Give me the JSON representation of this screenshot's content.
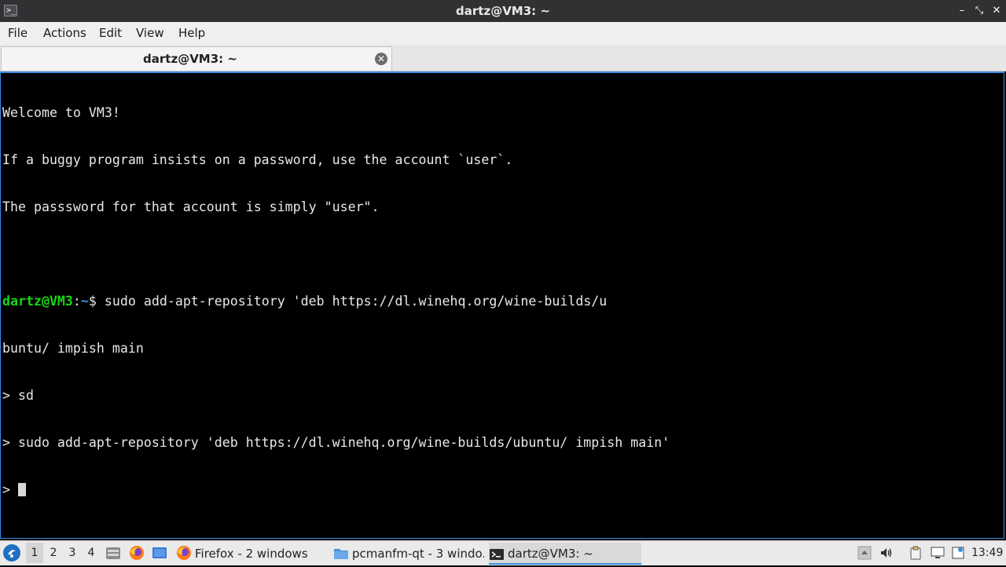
{
  "window": {
    "title": "dartz@VM3: ~",
    "app_icon": "terminal-icon",
    "app_icon_glyph": ">_",
    "controls": {
      "minimize": "–",
      "maximize": "⤡",
      "close": "✕"
    }
  },
  "menubar": {
    "items": [
      "File",
      "Actions",
      "Edit",
      "View",
      "Help"
    ]
  },
  "tabs": [
    {
      "label": "dartz@VM3: ~",
      "close_icon": "close-circle-icon",
      "close_glyph": "✕"
    }
  ],
  "terminal": {
    "lines": [
      "Welcome to VM3!",
      "If a buggy program insists on a password, use the account `user`.",
      "The passsword for that account is simply \"user\".",
      ""
    ],
    "prompt": {
      "user_host": "dartz@VM3",
      "colon": ":",
      "path": "~",
      "symbol": "$",
      "command": " sudo add-apt-repository 'deb https://dl.winehq.org/wine-builds/u"
    },
    "continuation_lines": [
      "buntu/ impish main",
      "> sd",
      "> sudo add-apt-repository 'deb https://dl.winehq.org/wine-builds/ubuntu/ impish main'"
    ],
    "current_prompt": "> "
  },
  "taskbar": {
    "start_icon": "start-menu-icon",
    "desktops": [
      "1",
      "2",
      "3",
      "4"
    ],
    "active_desktop": "1",
    "quicklaunch": [
      "file-manager-icon",
      "firefox-icon",
      "show-desktop-icon"
    ],
    "tasks": [
      {
        "label": "Firefox - 2 windows",
        "icon": "firefox-icon"
      },
      {
        "label": "pcmanfm-qt - 3 windo...",
        "icon": "folder-icon"
      },
      {
        "label": "dartz@VM3: ~",
        "icon": "terminal-icon"
      }
    ],
    "tray": [
      "tray-up-icon",
      "volume-icon",
      "clipboard-icon",
      "screen-icon",
      "network-icon"
    ],
    "clock": "13:49"
  },
  "colors": {
    "accent": "#3a8ee6",
    "prompt_user": "#19d619",
    "prompt_path": "#3b8eea",
    "terminal_bg": "#000000",
    "terminal_fg": "#e8e8e8"
  }
}
